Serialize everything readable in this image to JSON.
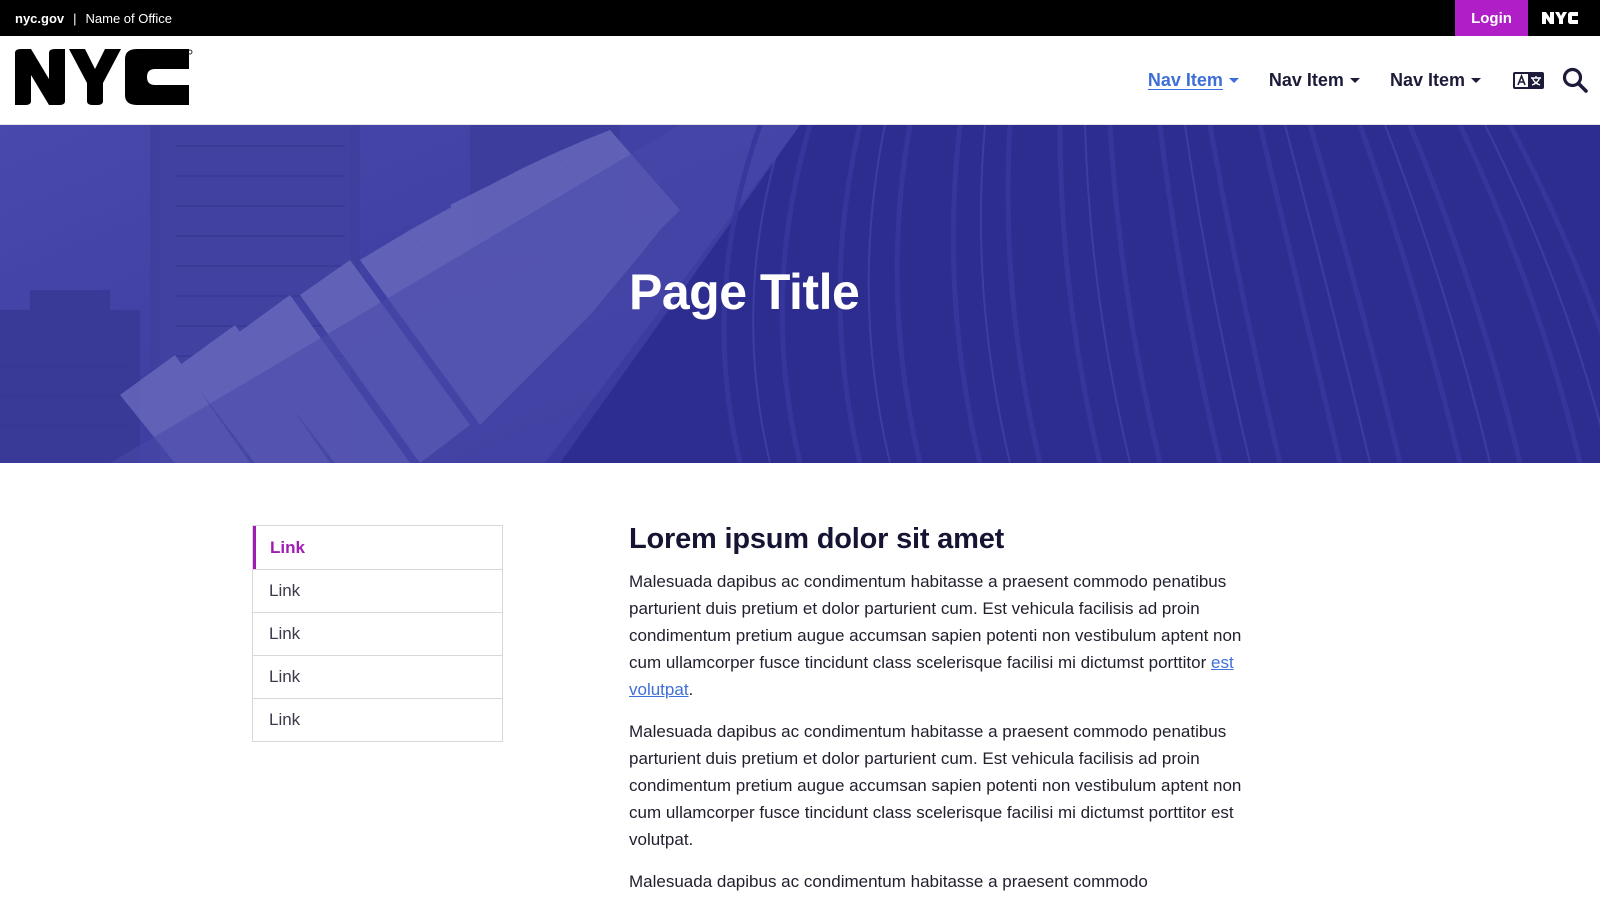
{
  "topbar": {
    "site": "nyc.gov",
    "separator": "|",
    "office": "Name of Office",
    "login_label": "Login",
    "logo_text": "NYC"
  },
  "header": {
    "logo_text": "NYC",
    "nav": [
      {
        "label": "Nav Item",
        "active": true
      },
      {
        "label": "Nav Item",
        "active": false
      },
      {
        "label": "Nav Item",
        "active": false
      }
    ],
    "icons": [
      "translate-icon",
      "search-icon"
    ]
  },
  "hero": {
    "title": "Page Title"
  },
  "sidenav": {
    "items": [
      {
        "label": "Link"
      },
      {
        "label": "Link"
      },
      {
        "label": "Link"
      },
      {
        "label": "Link"
      },
      {
        "label": "Link"
      }
    ]
  },
  "main": {
    "heading": "Lorem ipsum dolor sit amet",
    "p1_text": "Malesuada dapibus ac condimentum habitasse a praesent commodo penatibus parturient duis pretium et dolor parturient cum. Est vehicula facilisis ad proin condimentum pretium augue accumsan sapien potenti non vestibulum aptent non cum ullamcorper fusce tincidunt class scelerisque facilisi mi dictumst porttitor ",
    "p1_link": "est volutpat",
    "p1_end": ".",
    "p2": "Malesuada dapibus ac condimentum habitasse a praesent commodo penatibus parturient duis pretium et dolor parturient cum. Est vehicula facilisis ad proin condimentum pretium augue accumsan sapien potenti non vestibulum aptent non cum ullamcorper fusce tincidunt class scelerisque facilisi mi dictumst porttitor est volutpat.",
    "p3": "Malesuada dapibus ac condimentum habitasse a praesent commodo"
  },
  "colors": {
    "accent": "#b01ec8",
    "link": "#3e6fd8",
    "hero": "#2c2b8f"
  }
}
